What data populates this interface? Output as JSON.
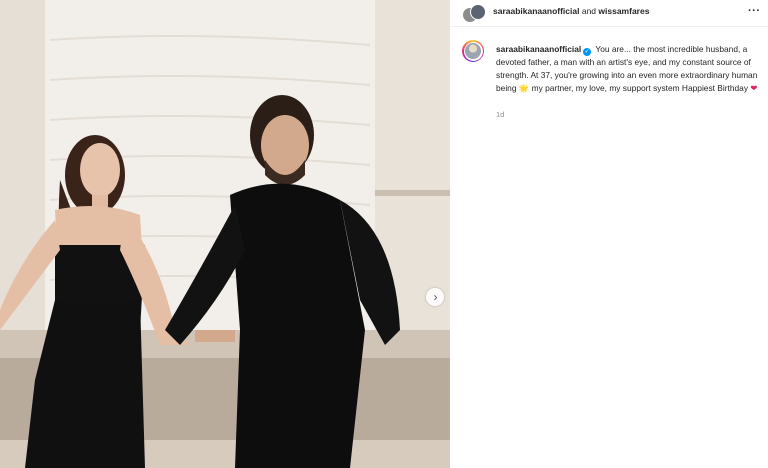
{
  "post": {
    "image_alt": "Photo of a woman in a black dress and a man in a black suit posing in front of a white wall",
    "next_icon": "chevron-right-icon"
  },
  "header": {
    "user1": "saraabikanaanofficial",
    "connector": "and",
    "user2": "wissamfares",
    "more_icon": "more-horizontal-icon",
    "more_label": "···"
  },
  "caption": {
    "username": "saraabikanaanofficial",
    "verified": true,
    "text_part1": "You are... the most incredible husband, a devoted father, a man with an artist's eye, and my constant source of strength. At 37, you're growing into an even more extraordinary human being",
    "emoji1": "🌟",
    "text_part2": "my partner, my love, my support system Happiest Birthday",
    "emoji2": "❤",
    "timestamp": "1d"
  },
  "colors": {
    "verified_badge": "#0095f6",
    "heart": "#e0245e",
    "muted_text": "#8e8e8e"
  }
}
